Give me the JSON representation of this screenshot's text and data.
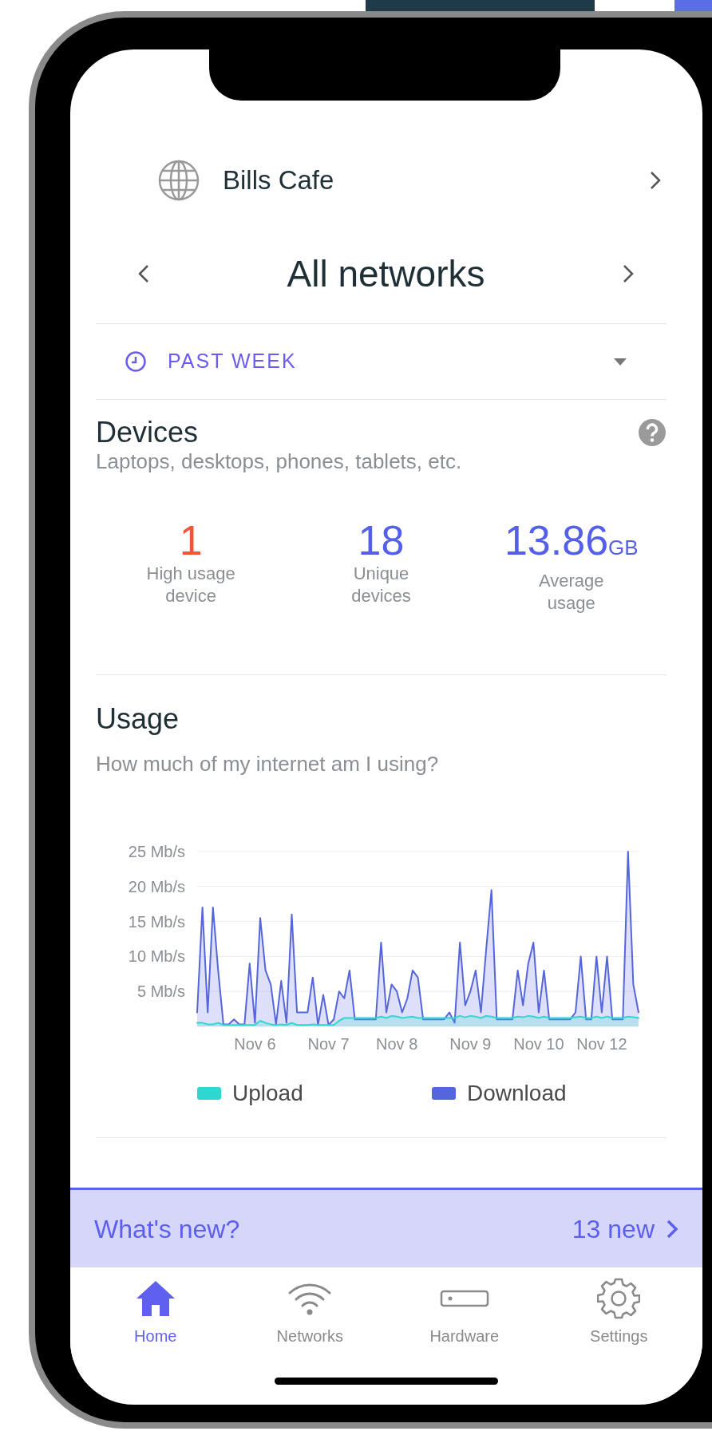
{
  "network": {
    "name": "Bills Cafe"
  },
  "selector": {
    "title": "All networks"
  },
  "time_filter": {
    "label": "PAST WEEK"
  },
  "devices": {
    "title": "Devices",
    "subtitle": "Laptops, desktops, phones, tablets, etc.",
    "stats": [
      {
        "value": "1",
        "label": "High usage device",
        "kind": "alert"
      },
      {
        "value": "18",
        "label": "Unique devices",
        "kind": "normal"
      },
      {
        "value": "13.86",
        "unit": "GB",
        "label": "Average usage",
        "kind": "normal"
      }
    ]
  },
  "usage": {
    "title": "Usage",
    "subtitle": "How much of my internet am I using?",
    "chart_data": {
      "type": "area",
      "grid": true,
      "ylim": [
        0,
        25
      ],
      "categories": [
        null,
        null,
        null,
        null,
        null,
        null,
        null,
        null,
        null,
        null,
        null,
        "Nov 6",
        null,
        null,
        null,
        null,
        null,
        null,
        null,
        null,
        null,
        null,
        null,
        null,
        null,
        "Nov 7",
        null,
        null,
        null,
        null,
        null,
        null,
        null,
        null,
        null,
        null,
        null,
        null,
        "Nov 8",
        null,
        null,
        null,
        null,
        null,
        null,
        null,
        null,
        null,
        null,
        null,
        null,
        null,
        "Nov 9",
        null,
        null,
        null,
        null,
        null,
        null,
        null,
        null,
        null,
        null,
        null,
        null,
        "Nov 10",
        null,
        null,
        null,
        null,
        null,
        null,
        null,
        null,
        null,
        null,
        null,
        "Nov 12",
        null,
        null,
        null,
        null,
        null,
        null,
        null
      ],
      "yticks": [
        {
          "value": 5,
          "label": "5 Mb/s"
        },
        {
          "value": 10,
          "label": "10 Mb/s"
        },
        {
          "value": 15,
          "label": "15 Mb/s"
        },
        {
          "value": 20,
          "label": "20 Mb/s"
        },
        {
          "value": 25,
          "label": "25 Mb/s"
        }
      ],
      "series": [
        {
          "name": "Upload",
          "color": "#2ed8d0",
          "values": [
            0.5,
            0.5,
            0.3,
            0.3,
            0.5,
            0.2,
            0.2,
            0.2,
            0.2,
            0.2,
            0.2,
            0.2,
            0.8,
            0.5,
            0.3,
            0.2,
            0.3,
            0.2,
            0.5,
            0.2,
            0.2,
            0.2,
            0.3,
            0.2,
            0.2,
            0.2,
            0.2,
            0.8,
            1.2,
            1.2,
            1.2,
            1.2,
            1.2,
            1.2,
            1.2,
            1.4,
            1.2,
            1.5,
            1.4,
            1.2,
            1.3,
            1.4,
            1.2,
            1.2,
            1.2,
            1.2,
            1.2,
            1.2,
            1.2,
            1.2,
            1.5,
            1.3,
            1.5,
            1.4,
            1.2,
            1.5,
            1.4,
            1.2,
            1.2,
            1.2,
            1.2,
            1.4,
            1.3,
            1.5,
            1.4,
            1.2,
            1.4,
            1.2,
            1.2,
            1.2,
            1.2,
            1.2,
            1.3,
            1.4,
            1.2,
            1.2,
            1.4,
            1.2,
            1.4,
            1.2,
            1.2,
            1.2,
            1.4,
            1.3,
            1.2
          ]
        },
        {
          "name": "Download",
          "color": "#5566dd",
          "values": [
            2,
            17,
            2,
            17,
            8,
            0.3,
            0.3,
            1,
            0.3,
            0.3,
            9,
            0.5,
            15.5,
            8,
            6,
            0.3,
            6.5,
            0.5,
            16,
            2,
            2,
            2,
            7,
            0.2,
            4.5,
            0.2,
            1,
            5,
            4,
            8,
            1,
            1,
            1,
            1,
            1,
            12,
            2,
            6,
            5,
            2,
            4,
            8,
            7,
            1,
            1,
            1,
            1,
            1,
            2,
            0.5,
            12,
            3,
            5,
            8,
            2,
            11,
            19.5,
            1,
            1,
            1,
            1,
            8,
            3,
            9,
            12,
            2,
            8,
            1,
            1,
            1,
            1,
            1,
            2,
            10,
            1,
            1,
            10,
            2,
            10,
            1,
            1,
            1,
            25,
            6,
            2
          ]
        }
      ]
    }
  },
  "whats_new": {
    "label": "What's new?",
    "count": "13 new"
  },
  "tab_bar": [
    {
      "label": "Home",
      "selected": true
    },
    {
      "label": "Networks",
      "selected": false
    },
    {
      "label": "Hardware",
      "selected": false
    },
    {
      "label": "Settings",
      "selected": false
    }
  ]
}
